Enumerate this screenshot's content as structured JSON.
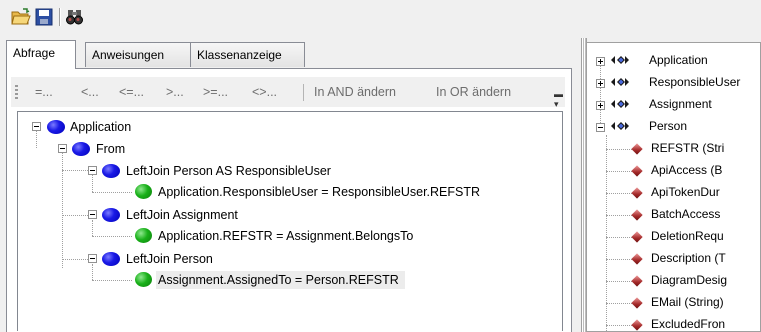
{
  "toolbar": {
    "icons": [
      "open-folder-icon",
      "save-icon",
      "binoculars-icon"
    ]
  },
  "tabs": [
    {
      "label": "Abfrage",
      "active": true
    },
    {
      "label": "Anweisungen",
      "active": false
    },
    {
      "label": "Klassenanzeige",
      "active": false
    }
  ],
  "filter": {
    "items": [
      "=...",
      "<...",
      "<=...",
      ">...",
      ">=...",
      "<>...",
      "In AND ändern",
      "In OR ändern"
    ]
  },
  "tree": {
    "application": "Application",
    "from": "From",
    "join1": "LeftJoin  Person AS ResponsibleUser",
    "cond1": "Application.ResponsibleUser = ResponsibleUser.REFSTR",
    "join2": "LeftJoin  Assignment",
    "cond2": "Application.REFSTR = Assignment.BelongsTo",
    "join3": "LeftJoin  Person",
    "cond3": "Assignment.AssignedTo = Person.REFSTR"
  },
  "classes": {
    "items": [
      {
        "label": "Application",
        "expanded": false
      },
      {
        "label": "ResponsibleUser",
        "expanded": false
      },
      {
        "label": "Assignment",
        "expanded": false
      },
      {
        "label": "Person",
        "expanded": true
      }
    ],
    "members": [
      "REFSTR (Stri",
      "ApiAccess (B",
      "ApiTokenDur",
      "BatchAccess",
      "DeletionRequ",
      "Description (T",
      "DiagramDesig",
      "EMail (String)",
      "ExcludedFron"
    ]
  }
}
